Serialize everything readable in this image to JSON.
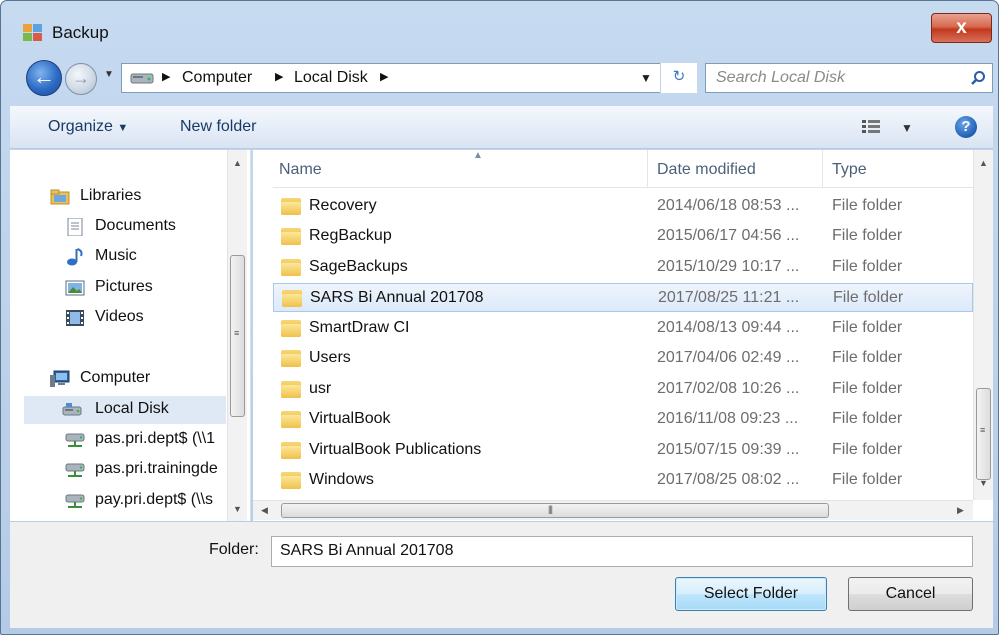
{
  "window": {
    "title": "Backup",
    "close_glyph": "x"
  },
  "address": {
    "breadcrumbs": [
      "Computer",
      "Local Disk"
    ],
    "search_placeholder": "Search Local Disk"
  },
  "toolbar": {
    "organize": "Organize",
    "new_folder": "New folder"
  },
  "nav": {
    "items": [
      {
        "label": "Libraries",
        "icon": "libraries-icon"
      },
      {
        "label": "Documents",
        "icon": "documents-icon"
      },
      {
        "label": "Music",
        "icon": "music-icon"
      },
      {
        "label": "Pictures",
        "icon": "pictures-icon"
      },
      {
        "label": "Videos",
        "icon": "videos-icon"
      },
      {
        "label": "Computer",
        "icon": "computer-icon"
      },
      {
        "label": "Local Disk",
        "icon": "local-disk-icon",
        "selected": true
      },
      {
        "label": "pas.pri.dept$ (\\\\1",
        "icon": "network-drive-icon"
      },
      {
        "label": "pas.pri.trainingde",
        "icon": "network-drive-icon"
      },
      {
        "label": "pay.pri.dept$ (\\\\s",
        "icon": "network-drive-icon"
      }
    ]
  },
  "list": {
    "columns": [
      "Name",
      "Date modified",
      "Type"
    ],
    "rows": [
      {
        "name": "Recovery",
        "date": "2014/06/18 08:53 ...",
        "type": "File folder"
      },
      {
        "name": "RegBackup",
        "date": "2015/06/17 04:56 ...",
        "type": "File folder"
      },
      {
        "name": "SageBackups",
        "date": "2015/10/29 10:17 ...",
        "type": "File folder"
      },
      {
        "name": "SARS Bi Annual 201708",
        "date": "2017/08/25 11:21 ...",
        "type": "File folder",
        "selected": true
      },
      {
        "name": "SmartDraw CI",
        "date": "2014/08/13 09:44 ...",
        "type": "File folder"
      },
      {
        "name": "Users",
        "date": "2017/04/06 02:49 ...",
        "type": "File folder"
      },
      {
        "name": "usr",
        "date": "2017/02/08 10:26 ...",
        "type": "File folder"
      },
      {
        "name": "VirtualBook",
        "date": "2016/11/08 09:23 ...",
        "type": "File folder"
      },
      {
        "name": "VirtualBook Publications",
        "date": "2015/07/15 09:39 ...",
        "type": "File folder"
      },
      {
        "name": "Windows",
        "date": "2017/08/25 08:02 ...",
        "type": "File folder"
      }
    ]
  },
  "bottom": {
    "folder_label": "Folder:",
    "folder_value": "SARS Bi Annual 201708",
    "select_button": "Select Folder",
    "cancel_button": "Cancel"
  },
  "colors": {
    "window_frame": "#b4cbe7",
    "selection": "#dceafa",
    "close_button": "#c2381b"
  }
}
